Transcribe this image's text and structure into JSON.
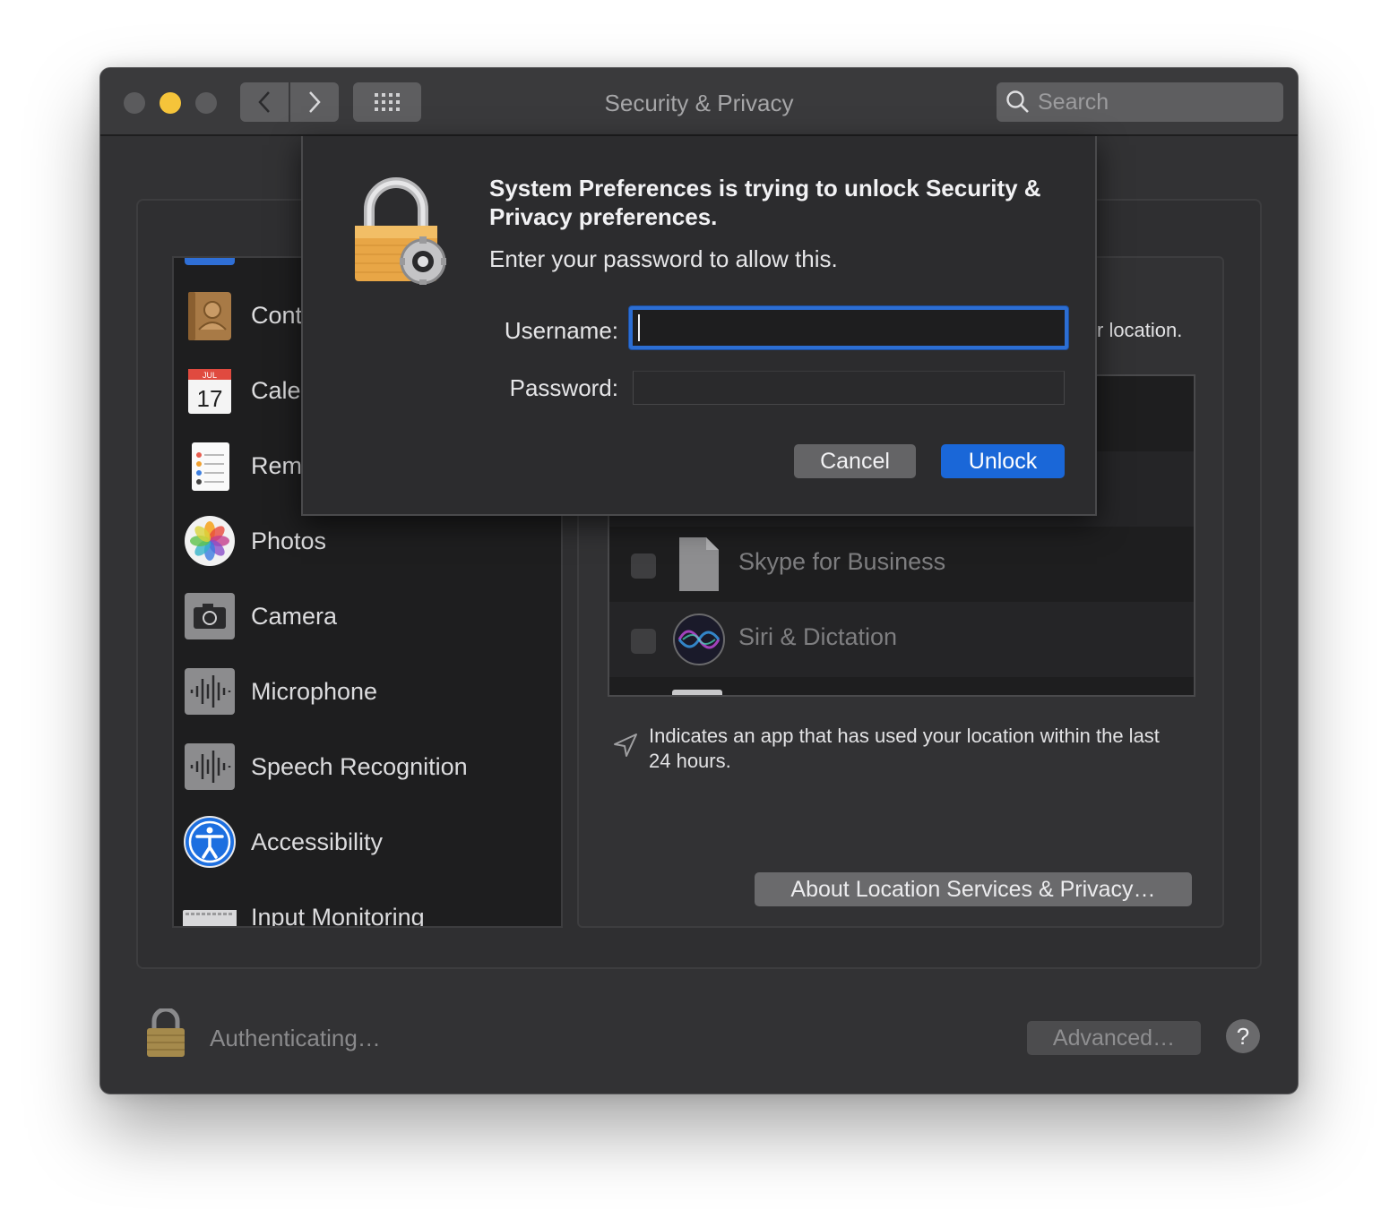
{
  "window": {
    "title": "Security & Privacy",
    "search_placeholder": "Search"
  },
  "sidebar": {
    "items": [
      {
        "label": "Cont",
        "icon": "contacts-icon"
      },
      {
        "label": "Cale",
        "icon": "calendar-icon",
        "calendar_month": "JUL",
        "calendar_day": "17"
      },
      {
        "label": "Rem",
        "icon": "reminders-icon"
      },
      {
        "label": "Photos",
        "icon": "photos-icon"
      },
      {
        "label": "Camera",
        "icon": "camera-icon"
      },
      {
        "label": "Microphone",
        "icon": "microphone-icon"
      },
      {
        "label": "Speech Recognition",
        "icon": "speech-recognition-icon"
      },
      {
        "label": "Accessibility",
        "icon": "accessibility-icon"
      },
      {
        "label": "Input Monitoring",
        "icon": "keyboard-icon"
      }
    ]
  },
  "location": {
    "tail_text": "r location.",
    "apps": [
      {
        "label": "Skype for Business",
        "icon": "document-icon",
        "checked": false
      },
      {
        "label": "Siri & Dictation",
        "icon": "siri-icon",
        "checked": false
      }
    ],
    "note": "Indicates an app that has used your location within the last 24 hours.",
    "about_button": "About Location Services & Privacy…"
  },
  "footer": {
    "auth_status": "Authenticating…",
    "advanced_button": "Advanced…",
    "help_button": "?"
  },
  "dialog": {
    "title": "System Preferences is trying to unlock Security & Privacy preferences.",
    "subtitle": "Enter your password to allow this.",
    "username_label": "Username:",
    "username_value": "",
    "password_label": "Password:",
    "password_value": "",
    "cancel_button": "Cancel",
    "unlock_button": "Unlock"
  },
  "colors": {
    "accent": "#1a67d8",
    "focus_ring": "#2c6ed3",
    "minimize": "#f5c43a"
  }
}
